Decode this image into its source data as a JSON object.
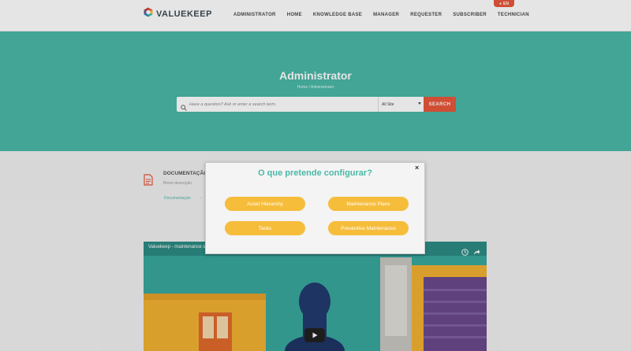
{
  "header": {
    "logo_text": "VALUEKEEP",
    "nav": [
      "ADMINISTRATOR",
      "HOME",
      "KNOWLEDGE BASE",
      "MANAGER",
      "REQUESTER",
      "SUBSCRIBER",
      "TECHNICIAN"
    ],
    "language": "EN"
  },
  "hero": {
    "title": "Administrator",
    "breadcrumb": "Home / Administrator",
    "search_placeholder": "Have a question? Ask or enter a search term.",
    "search_scope": "All Site",
    "search_button": "SEARCH"
  },
  "docs": {
    "title": "DOCUMENTAÇÃO",
    "description": "Breve descrição",
    "link": "Documentação",
    "link_arrow": "→"
  },
  "video": {
    "title": "Valuekeep - maintenance software"
  },
  "modal": {
    "title": "O que pretende configurar?",
    "close": "×",
    "buttons": [
      "Asset Hierarchy",
      "Maintenance Plans",
      "Tasks",
      "Preventive Maintenance"
    ]
  },
  "colors": {
    "teal": "#4ab8a8",
    "orange": "#e8573a",
    "yellow": "#f6bd3b"
  },
  "icons": {
    "logo": "hexagon-logo-icon",
    "search": "search-icon",
    "document": "document-icon",
    "clock": "clock-icon",
    "share": "share-icon",
    "play": "play-icon"
  }
}
